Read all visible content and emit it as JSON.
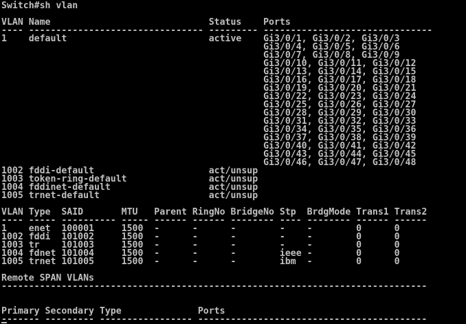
{
  "terminal": {
    "lines": [
      "Switch#sh vlan",
      "",
      "VLAN Name                             Status    Ports",
      "---- -------------------------------- --------- -------------------------------",
      "1    default                          active    Gi3/0/1, Gi3/0/2, Gi3/0/3",
      "                                                Gi3/0/4, Gi3/0/5, Gi3/0/6",
      "                                                Gi3/0/7, Gi3/0/8, Gi3/0/9",
      "                                                Gi3/0/10, Gi3/0/11, Gi3/0/12",
      "                                                Gi3/0/13, Gi3/0/14, Gi3/0/15",
      "                                                Gi3/0/16, Gi3/0/17, Gi3/0/18",
      "                                                Gi3/0/19, Gi3/0/20, Gi3/0/21",
      "                                                Gi3/0/22, Gi3/0/23, Gi3/0/24",
      "                                                Gi3/0/25, Gi3/0/26, Gi3/0/27",
      "                                                Gi3/0/28, Gi3/0/29, Gi3/0/30",
      "                                                Gi3/0/31, Gi3/0/32, Gi3/0/33",
      "                                                Gi3/0/34, Gi3/0/35, Gi3/0/36",
      "                                                Gi3/0/37, Gi3/0/38, Gi3/0/39",
      "                                                Gi3/0/40, Gi3/0/41, Gi3/0/42",
      "                                                Gi3/0/43, Gi3/0/44, Gi3/0/45",
      "                                                Gi3/0/46, Gi3/0/47, Gi3/0/48",
      "1002 fddi-default                     act/unsup",
      "1003 token-ring-default               act/unsup",
      "1004 fddinet-default                  act/unsup",
      "1005 trnet-default                    act/unsup",
      "",
      "VLAN Type  SAID       MTU   Parent RingNo BridgeNo Stp  BrdgMode Trans1 Trans2",
      "---- ----- ---------- ----- ------ ------ -------- ---- -------- ------ ------",
      "1    enet  100001     1500  -      -      -        -    -        0      0",
      "1002 fddi  101002     1500  -      -      -        -    -        0      0",
      "1003 tr    101003     1500  -      -      -        -    -        0      0",
      "1004 fdnet 101004     1500  -      -      -        ieee -        0      0",
      "1005 trnet 101005     1500  -      -      -        ibm  -        0      0",
      "",
      "Remote SPAN VLANs",
      "------------------------------------------------------------------------------",
      "",
      "",
      "Primary Secondary Type              Ports",
      "------- --------- ----------------- ------------------------------------------"
    ]
  }
}
